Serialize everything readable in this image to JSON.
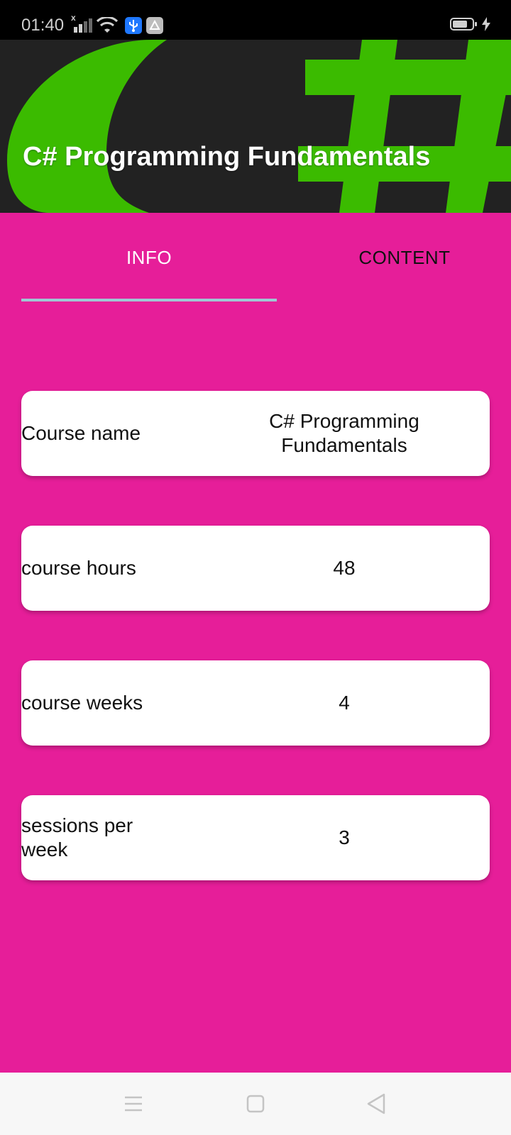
{
  "status_bar": {
    "time": "01:40",
    "icons": [
      "signal-icon",
      "wifi-icon",
      "usb-icon",
      "debug-icon",
      "battery-icon",
      "charging-icon"
    ]
  },
  "header": {
    "title": "C# Programming Fundamentals",
    "banner_colors": {
      "background": "#242424",
      "logo": "#3fc600"
    }
  },
  "tabs": [
    {
      "label": "INFO",
      "selected": true
    },
    {
      "label": "CONTENT",
      "selected": false
    }
  ],
  "course_info": [
    {
      "label": "Course name",
      "value": "C# Programming Fundamentals"
    },
    {
      "label": "course hours",
      "value": "48"
    },
    {
      "label": "course weeks",
      "value": "4"
    },
    {
      "label": "sessions per week",
      "value": "3"
    }
  ],
  "colors": {
    "page_background": "#e61e99",
    "tab_indicator": "#9fc8d4",
    "card_background": "#ffffff"
  },
  "nav_bar": {
    "buttons": [
      "menu-icon",
      "home-icon",
      "back-icon"
    ]
  }
}
